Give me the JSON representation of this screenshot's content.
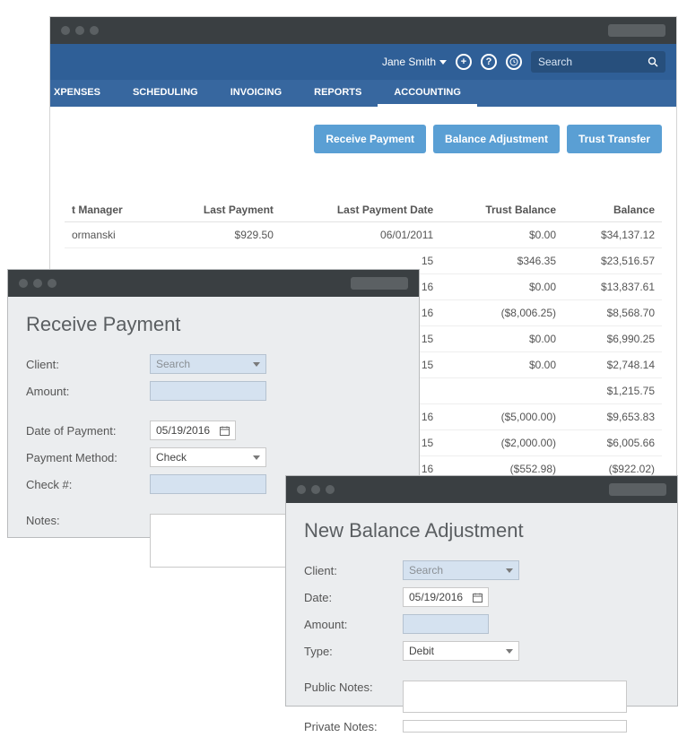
{
  "header": {
    "user_name": "Jane Smith",
    "search_placeholder": "Search"
  },
  "nav": {
    "items": [
      "XPENSES",
      "SCHEDULING",
      "INVOICING",
      "REPORTS",
      "ACCOUNTING"
    ],
    "active_index": 4
  },
  "actions": {
    "receive_payment": "Receive Payment",
    "balance_adjustment": "Balance Adjustment",
    "trust_transfer": "Trust Transfer"
  },
  "table": {
    "headers": [
      "t Manager",
      "Last Payment",
      "Last Payment Date",
      "Trust Balance",
      "Balance"
    ],
    "rows": [
      {
        "c0": "ormanski",
        "c1": "$929.50",
        "c2": "06/01/2011",
        "c3": "$0.00",
        "c4": "$34,137.12"
      },
      {
        "c0": "",
        "c1": "",
        "c2": "15",
        "c3": "$346.35",
        "c4": "$23,516.57",
        "c3_class": "red"
      },
      {
        "c0": "",
        "c1": "",
        "c2": "16",
        "c3": "$0.00",
        "c4": "$13,837.61"
      },
      {
        "c0": "",
        "c1": "",
        "c2": "16",
        "c3": "($8,006.25)",
        "c4": "$8,568.70"
      },
      {
        "c0": "",
        "c1": "",
        "c2": "15",
        "c3": "$0.00",
        "c4": "$6,990.25"
      },
      {
        "c0": "",
        "c1": "",
        "c2": "15",
        "c3": "$0.00",
        "c4": "$2,748.14"
      },
      {
        "c0": "",
        "c1": "",
        "c2": "",
        "c3": "",
        "c4": "$1,215.75"
      },
      {
        "c0": "",
        "c1": "",
        "c2": "16",
        "c3": "($5,000.00)",
        "c4": "$9,653.83"
      },
      {
        "c0": "",
        "c1": "",
        "c2": "15",
        "c3": "($2,000.00)",
        "c4": "$6,005.66"
      },
      {
        "c0": "",
        "c1": "",
        "c2": "16",
        "c3": "($552.98)",
        "c4": "($922.02)",
        "c4_class": "green"
      }
    ]
  },
  "receive_dialog": {
    "title": "Receive Payment",
    "client_label": "Client:",
    "client_placeholder": "Search",
    "amount_label": "Amount:",
    "date_label": "Date of Payment:",
    "date_value": "05/19/2016",
    "method_label": "Payment Method:",
    "method_value": "Check",
    "check_label": "Check #:",
    "notes_label": "Notes:"
  },
  "balance_dialog": {
    "title": "New Balance Adjustment",
    "client_label": "Client:",
    "client_placeholder": "Search",
    "date_label": "Date:",
    "date_value": "05/19/2016",
    "amount_label": "Amount:",
    "type_label": "Type:",
    "type_value": "Debit",
    "public_notes_label": "Public Notes:",
    "private_notes_label": "Private Notes:"
  }
}
